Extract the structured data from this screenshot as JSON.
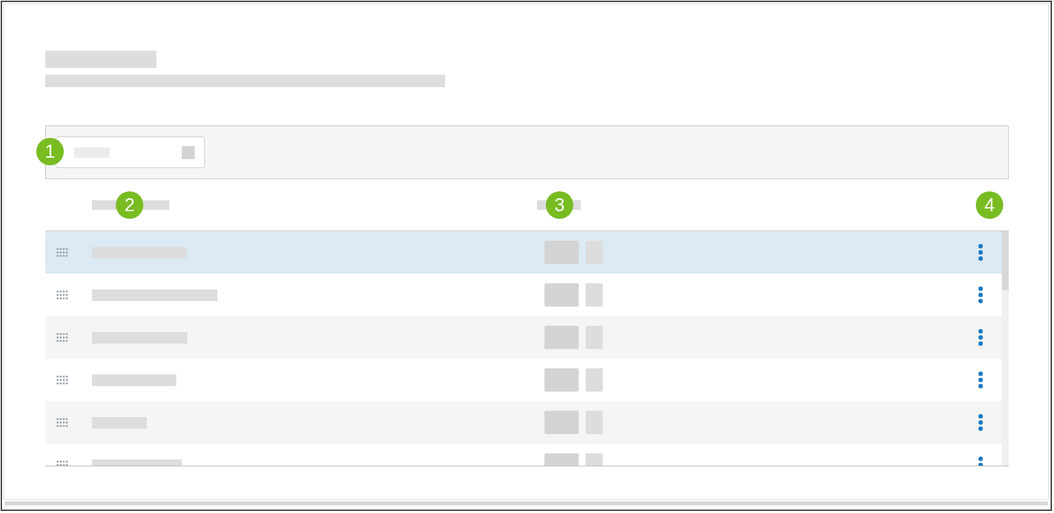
{
  "callouts": [
    {
      "label": "1"
    },
    {
      "label": "2"
    },
    {
      "label": "3"
    },
    {
      "label": "4"
    }
  ],
  "rows": [
    {
      "selected": true
    },
    {
      "selected": false
    },
    {
      "selected": false
    },
    {
      "selected": false
    },
    {
      "selected": false
    },
    {
      "selected": false
    }
  ]
}
